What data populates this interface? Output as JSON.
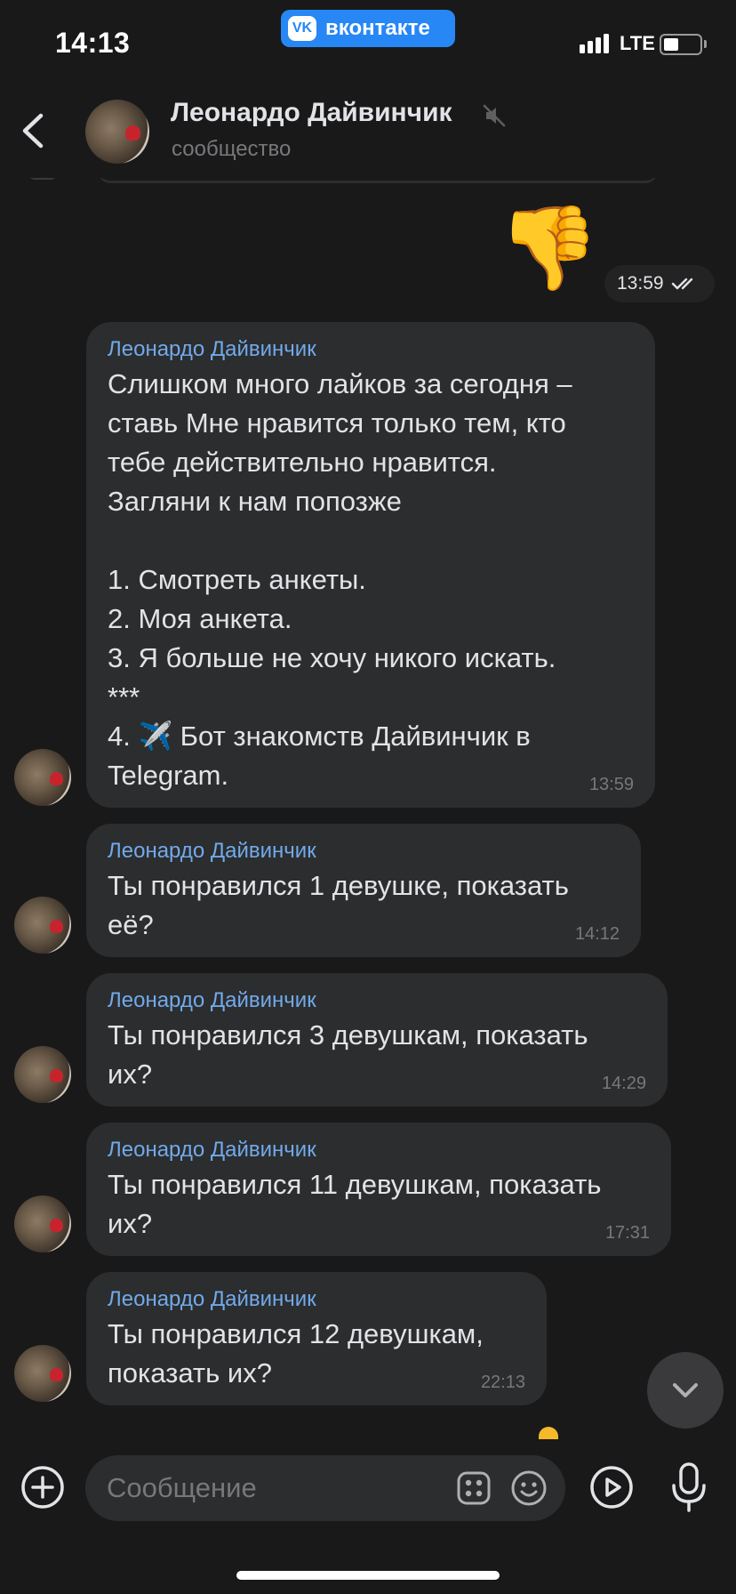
{
  "status_bar": {
    "time": "14:13",
    "carrier_app": "вконтакте",
    "vk_logo": "VK",
    "network": "LTE",
    "battery_level": 0.35,
    "signal_bars": 4
  },
  "header": {
    "title": "Леонардо Дайвинчик",
    "subtitle": "сообщество",
    "muted": true,
    "avatar_icon": "leonardo-avatar-icon"
  },
  "outgoing": {
    "sticker_emoji": "👎",
    "time": "13:59",
    "status_icon": "double-check-icon"
  },
  "messages": [
    {
      "author": "Леонардо Дайвинчик",
      "text": "Слишком много лайков за сегодня –\nставь Мне нравится только тем, кто\nтебе действительно нравится.\nЗагляни к нам попозже\n\n1. Смотреть анкеты.\n2. Моя анкета.\n3. Я больше не хочу никого искать.\n***\n4. ✈️ Бот знакомств Дайвинчик в\nTelegram.",
      "time": "13:59"
    },
    {
      "author": "Леонардо Дайвинчик",
      "text": "Ты понравился 1 девушке, показать\neё?",
      "time": "14:12"
    },
    {
      "author": "Леонардо Дайвинчик",
      "text": "Ты понравился 3 девушкам, показать\nих?",
      "time": "14:29"
    },
    {
      "author": "Леонардо Дайвинчик",
      "text": "Ты понравился 11 девушкам, показать\nих?",
      "time": "17:31"
    },
    {
      "author": "Леонардо Дайвинчик",
      "text": "Ты понравился 12 девушкам,\nпоказать их?",
      "time": "22:13"
    }
  ],
  "composer": {
    "placeholder": "Сообщение",
    "icons": [
      "plus-icon",
      "apps-icon",
      "emoji-icon",
      "video-message-icon",
      "microphone-icon"
    ]
  },
  "colors": {
    "background": "#19191a",
    "bubble": "#2c2d2e",
    "author": "#71aaeb",
    "text": "#e1e3e6",
    "secondary": "#76787a",
    "vk_blue": "#2787f5"
  }
}
